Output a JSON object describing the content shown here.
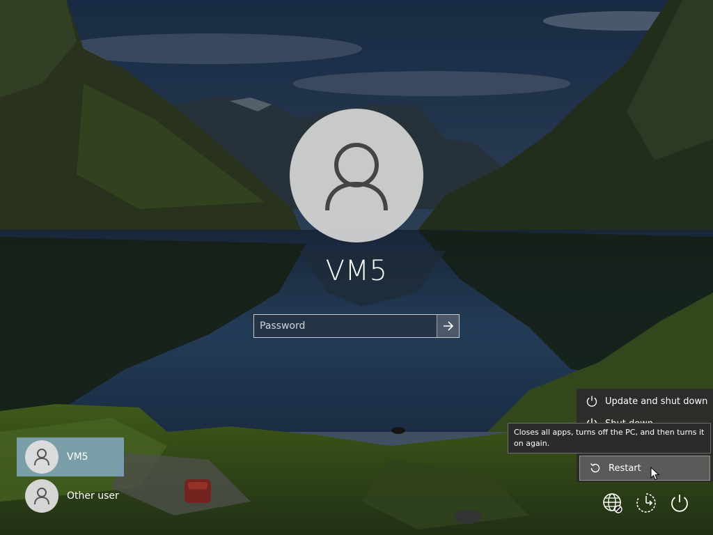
{
  "lock_screen": {
    "username": "VM5",
    "password": {
      "placeholder": "Password",
      "value": ""
    }
  },
  "user_list": [
    {
      "label": "VM5",
      "selected": true,
      "icon": "user-icon"
    },
    {
      "label": "Other user",
      "selected": false,
      "icon": "user-icon"
    }
  ],
  "power_menu": {
    "items": [
      {
        "label": "Update and shut down",
        "icon": "power-icon"
      },
      {
        "label": "Shut down",
        "icon": "power-icon"
      },
      {
        "label": "Restart",
        "icon": "restart-icon",
        "hovered": true
      }
    ],
    "tooltip": "Closes all apps, turns off the PC, and then turns it on again."
  },
  "system_icons": [
    "network-icon",
    "accessibility-icon",
    "power-icon"
  ],
  "colors": {
    "selected_user_bg": "#8cb4d6",
    "menu_bg": "#2b2b2b",
    "text": "#ffffff"
  }
}
